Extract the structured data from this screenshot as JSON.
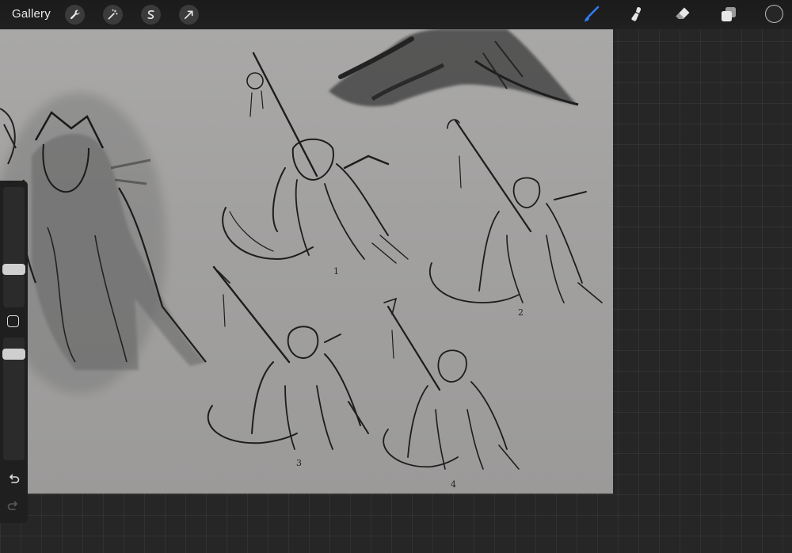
{
  "topbar": {
    "gallery_label": "Gallery",
    "tools": [
      "wrench-icon",
      "magic-wand-icon",
      "selection-icon",
      "transform-arrow-icon"
    ],
    "right_tools": [
      "brush-icon",
      "smudge-icon",
      "eraser-icon",
      "layers-icon"
    ],
    "active_tool": "brush-icon",
    "accent_color": "#2f7cf6",
    "current_color": "#262626"
  },
  "canvas": {
    "sketch_numbers": [
      "1",
      "2",
      "3",
      "4"
    ],
    "paper_color": "#a5a4a3"
  },
  "sidebar": {
    "brush_size_level": 0.3,
    "opacity_level": 0.9
  }
}
